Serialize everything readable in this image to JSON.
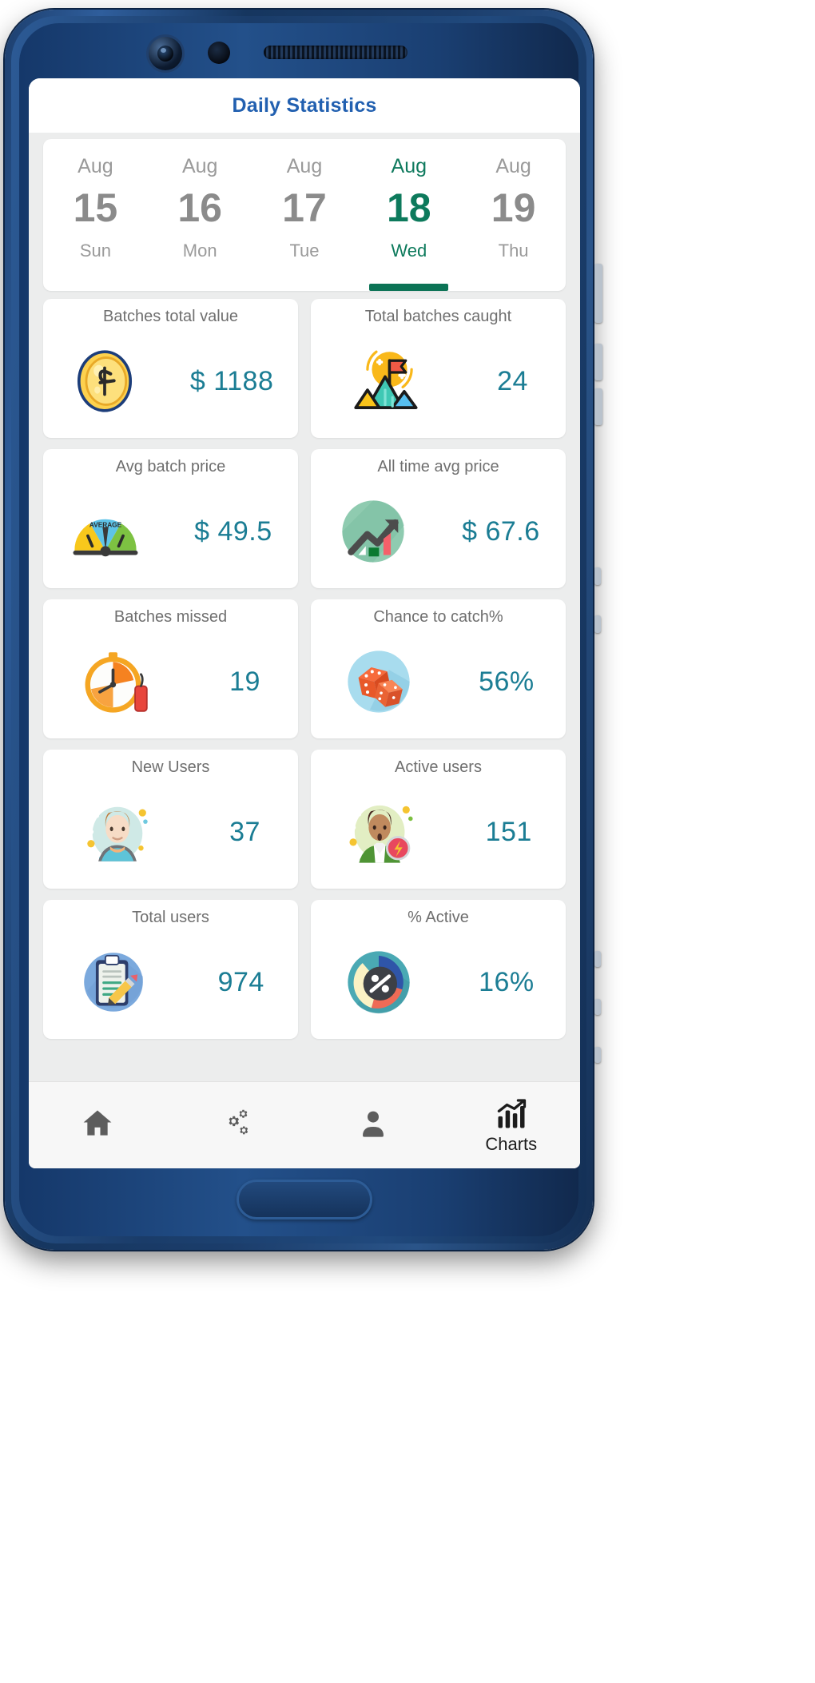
{
  "app": {
    "title": "Daily Statistics"
  },
  "date_strip": {
    "days": [
      {
        "month": "Aug",
        "day": "15",
        "dow": "Sun",
        "selected": false
      },
      {
        "month": "Aug",
        "day": "16",
        "dow": "Mon",
        "selected": false
      },
      {
        "month": "Aug",
        "day": "17",
        "dow": "Tue",
        "selected": false
      },
      {
        "month": "Aug",
        "day": "18",
        "dow": "Wed",
        "selected": true
      },
      {
        "month": "Aug",
        "day": "19",
        "dow": "Thu",
        "selected": false
      }
    ],
    "selected_index": 3,
    "selected_color": "#0b7355"
  },
  "stats": {
    "cards": [
      {
        "label": "Batches total value",
        "value": "$ 1188",
        "icon": "gold-coin-icon"
      },
      {
        "label": "Total batches caught",
        "value": "24",
        "icon": "mountain-flag-icon"
      },
      {
        "label": "Avg batch price",
        "value": "$ 49.5",
        "icon": "gauge-icon"
      },
      {
        "label": "All time avg price",
        "value": "$ 67.6",
        "icon": "growth-chart-icon"
      },
      {
        "label": "Batches missed",
        "value": "19",
        "icon": "timer-dynamite-icon"
      },
      {
        "label": "Chance to catch%",
        "value": "56%",
        "icon": "dice-icon"
      },
      {
        "label": "New Users",
        "value": "37",
        "icon": "new-user-avatar-icon"
      },
      {
        "label": "Active users",
        "value": "151",
        "icon": "active-user-avatar-icon"
      },
      {
        "label": "Total users",
        "value": "974",
        "icon": "clipboard-icon"
      },
      {
        "label": "% Active",
        "value": "16%",
        "icon": "percent-pie-icon"
      }
    ],
    "value_color": "#1b7d94",
    "label_color": "#6f6f6f"
  },
  "bottom_nav": {
    "items": [
      {
        "label": "",
        "icon": "home-icon",
        "active": false
      },
      {
        "label": "",
        "icon": "gears-icon",
        "active": false
      },
      {
        "label": "",
        "icon": "person-icon",
        "active": false
      },
      {
        "label": "Charts",
        "icon": "charts-icon",
        "active": true
      }
    ]
  }
}
